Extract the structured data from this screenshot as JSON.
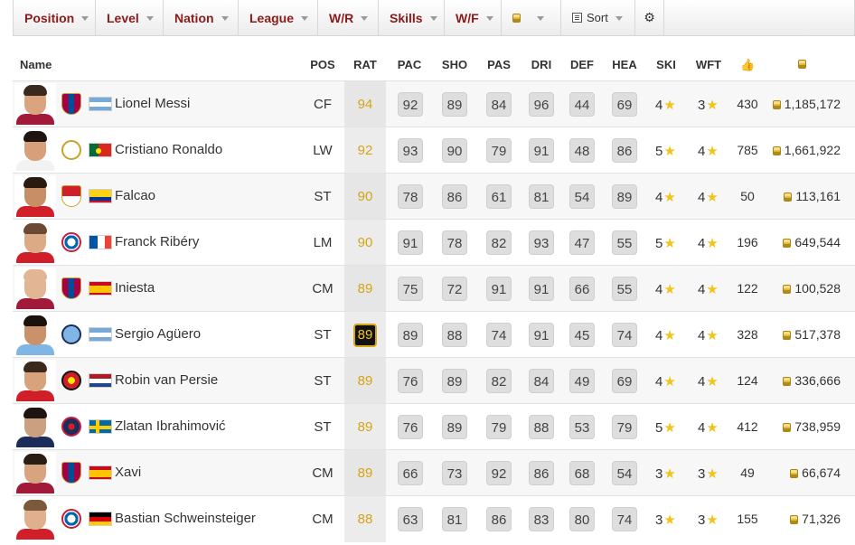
{
  "filters": [
    {
      "label": "Position",
      "w": 91
    },
    {
      "label": "Level",
      "w": 75
    },
    {
      "label": "Nation",
      "w": 83
    },
    {
      "label": "League",
      "w": 88
    },
    {
      "label": "W/R",
      "w": 67
    },
    {
      "label": "Skills",
      "w": 73
    },
    {
      "label": "W/F",
      "w": 63
    }
  ],
  "sort_label": "Sort",
  "columns": {
    "name": "Name",
    "pos": "POS",
    "rat": "RAT",
    "pac": "PAC",
    "sho": "SHO",
    "pas": "PAS",
    "dri": "DRI",
    "def": "DEF",
    "hea": "HEA",
    "ski": "SKI",
    "wft": "WFT"
  },
  "players": [
    {
      "name": "Lionel Messi",
      "pos": "CF",
      "rat": "94",
      "pac": "92",
      "sho": "89",
      "pas": "84",
      "dri": "96",
      "def": "44",
      "hea": "69",
      "ski": "4",
      "wft": "3",
      "likes": "430",
      "price": "1,185,172",
      "club": "barcelona",
      "nation": "argentina",
      "skin": "#d9a47e",
      "hair": "#3a2a1e",
      "kit": "#a11a3a"
    },
    {
      "name": "Cristiano Ronaldo",
      "pos": "LW",
      "rat": "92",
      "pac": "93",
      "sho": "90",
      "pas": "79",
      "dri": "91",
      "def": "48",
      "hea": "86",
      "ski": "5",
      "wft": "4",
      "likes": "785",
      "price": "1,661,922",
      "club": "realmadrid",
      "nation": "portugal",
      "skin": "#d7a07a",
      "hair": "#1e1510",
      "kit": "#f2f2f2"
    },
    {
      "name": "Falcao",
      "pos": "ST",
      "rat": "90",
      "pac": "78",
      "sho": "86",
      "pas": "61",
      "dri": "81",
      "def": "54",
      "hea": "89",
      "ski": "4",
      "wft": "4",
      "likes": "50",
      "price": "113,161",
      "club": "monaco",
      "nation": "colombia",
      "skin": "#c88f66",
      "hair": "#2a1a10",
      "kit": "#d11f2a"
    },
    {
      "name": "Franck Ribéry",
      "pos": "LM",
      "rat": "90",
      "pac": "91",
      "sho": "78",
      "pas": "82",
      "dri": "93",
      "def": "47",
      "hea": "55",
      "ski": "5",
      "wft": "4",
      "likes": "196",
      "price": "649,544",
      "club": "bayern",
      "nation": "france",
      "skin": "#dcab86",
      "hair": "#6b4a33",
      "kit": "#d11f2a"
    },
    {
      "name": "Iniesta",
      "pos": "CM",
      "rat": "89",
      "pac": "75",
      "sho": "72",
      "pas": "91",
      "dri": "91",
      "def": "66",
      "hea": "55",
      "ski": "4",
      "wft": "4",
      "likes": "122",
      "price": "100,528",
      "club": "barcelona",
      "nation": "spain",
      "skin": "#e2b595",
      "hair": "#e2b595",
      "kit": "#a11a3a"
    },
    {
      "name": "Sergio Agüero",
      "pos": "ST",
      "rat": "89",
      "pac": "89",
      "sho": "88",
      "pas": "74",
      "dri": "91",
      "def": "45",
      "hea": "74",
      "ski": "4",
      "wft": "4",
      "likes": "328",
      "price": "517,378",
      "club": "mancity",
      "nation": "argentina",
      "skin": "#c9926b",
      "hair": "#1a120c",
      "kit": "#7fb6e6",
      "highlight": true
    },
    {
      "name": "Robin van Persie",
      "pos": "ST",
      "rat": "89",
      "pac": "76",
      "sho": "89",
      "pas": "82",
      "dri": "84",
      "def": "49",
      "hea": "69",
      "ski": "4",
      "wft": "4",
      "likes": "124",
      "price": "336,666",
      "club": "manutd",
      "nation": "netherlands",
      "skin": "#d8a27c",
      "hair": "#3b2a1c",
      "kit": "#d11f2a"
    },
    {
      "name": "Zlatan Ibrahimović",
      "pos": "ST",
      "rat": "89",
      "pac": "76",
      "sho": "89",
      "pas": "79",
      "dri": "88",
      "def": "53",
      "hea": "79",
      "ski": "5",
      "wft": "4",
      "likes": "412",
      "price": "738,959",
      "club": "psg",
      "nation": "sweden",
      "skin": "#caa080",
      "hair": "#1e1510",
      "kit": "#1c2c5b"
    },
    {
      "name": "Xavi",
      "pos": "CM",
      "rat": "89",
      "pac": "66",
      "sho": "73",
      "pas": "92",
      "dri": "86",
      "def": "68",
      "hea": "54",
      "ski": "3",
      "wft": "3",
      "likes": "49",
      "price": "66,674",
      "club": "barcelona",
      "nation": "spain",
      "skin": "#d7a47f",
      "hair": "#2a1d14",
      "kit": "#a11a3a"
    },
    {
      "name": "Bastian Schweinsteiger",
      "pos": "CM",
      "rat": "88",
      "pac": "63",
      "sho": "81",
      "pas": "86",
      "dri": "83",
      "def": "80",
      "hea": "74",
      "ski": "3",
      "wft": "3",
      "likes": "155",
      "price": "71,326",
      "club": "bayern",
      "nation": "germany",
      "skin": "#e0b08c",
      "hair": "#7a5a3a",
      "kit": "#d11f2a"
    }
  ]
}
